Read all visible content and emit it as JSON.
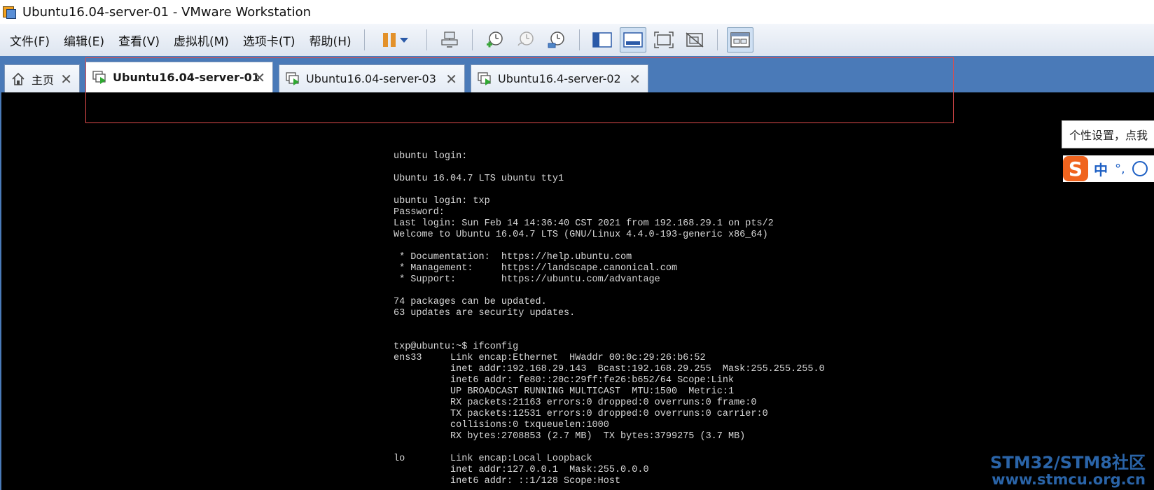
{
  "window": {
    "title": "Ubuntu16.04-server-01 - VMware Workstation"
  },
  "menu": {
    "items": [
      {
        "label": "文件(F)"
      },
      {
        "label": "编辑(E)"
      },
      {
        "label": "查看(V)"
      },
      {
        "label": "虚拟机(M)"
      },
      {
        "label": "选项卡(T)"
      },
      {
        "label": "帮助(H)"
      }
    ]
  },
  "toolbar": {
    "icons": [
      "pause-icon",
      "dropdown-chevron-icon",
      "send-ctrl-alt-del-icon",
      "snapshot-icon",
      "revert-snapshot-icon",
      "snapshot-manager-icon",
      "library-icon",
      "console-view-icon",
      "fullscreen-icon",
      "unity-icon",
      "thumbnail-bar-icon"
    ],
    "accent": "#e3912a"
  },
  "tabs": [
    {
      "label": "主页",
      "icon": "home-icon",
      "selected": false
    },
    {
      "label": "Ubuntu16.04-server-01",
      "icon": "vm-running-icon",
      "selected": true
    },
    {
      "label": "Ubuntu16.04-server-03",
      "icon": "vm-running-icon",
      "selected": false
    },
    {
      "label": "Ubuntu16.4-server-02",
      "icon": "vm-running-icon",
      "selected": false
    }
  ],
  "tab_close_glyph": "✕",
  "console": {
    "text": "ubuntu login:\n\nUbuntu 16.04.7 LTS ubuntu tty1\n\nubuntu login: txp\nPassword:\nLast login: Sun Feb 14 14:36:40 CST 2021 from 192.168.29.1 on pts/2\nWelcome to Ubuntu 16.04.7 LTS (GNU/Linux 4.4.0-193-generic x86_64)\n\n * Documentation:  https://help.ubuntu.com\n * Management:     https://landscape.canonical.com\n * Support:        https://ubuntu.com/advantage\n\n74 packages can be updated.\n63 updates are security updates.\n\n\ntxp@ubuntu:~$ ifconfig\nens33     Link encap:Ethernet  HWaddr 00:0c:29:26:b6:52\n          inet addr:192.168.29.143  Bcast:192.168.29.255  Mask:255.255.255.0\n          inet6 addr: fe80::20c:29ff:fe26:b652/64 Scope:Link\n          UP BROADCAST RUNNING MULTICAST  MTU:1500  Metric:1\n          RX packets:21163 errors:0 dropped:0 overruns:0 frame:0\n          TX packets:12531 errors:0 dropped:0 overruns:0 carrier:0\n          collisions:0 txqueuelen:1000\n          RX bytes:2708853 (2.7 MB)  TX bytes:3799275 (3.7 MB)\n\nlo        Link encap:Local Loopback\n          inet addr:127.0.0.1  Mask:255.0.0.0\n          inet6 addr: ::1/128 Scope:Host"
  },
  "ime": {
    "tooltip": "个性设置，点我",
    "logo": "S",
    "mode": "中",
    "punct": "°,"
  },
  "watermark": {
    "line1": "STM32/STM8社区",
    "line2": "www.stmcu.org.cn"
  },
  "colors": {
    "tabbar": "#4a7ab8",
    "highlight": "#e04b4b",
    "console_bg": "#000000",
    "console_fg": "#d8d8d8"
  }
}
